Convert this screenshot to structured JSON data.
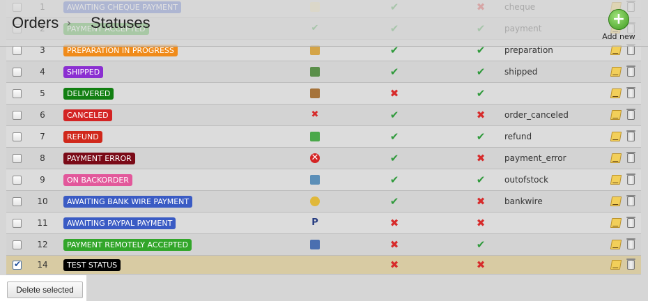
{
  "header": {
    "breadcrumb_root": "Orders",
    "breadcrumb_sep": "›",
    "breadcrumb_current": "Statuses",
    "add_new_label": "Add new",
    "add_new_icon": "+"
  },
  "rows": [
    {
      "id": "1",
      "status": "AWAITING CHEQUE PAYMENT",
      "color": "#4a64c8",
      "icon": "cheque-icon",
      "col1": "ok",
      "col2": "no",
      "template": "cheque",
      "checked": false
    },
    {
      "id": "2",
      "status": "PAYMENT ACCEPTED",
      "color": "#32a62a",
      "icon": "payment-icon",
      "col1": "ok",
      "col2": "ok",
      "template": "payment",
      "checked": false
    },
    {
      "id": "3",
      "status": "PREPARATION IN PROGRESS",
      "color": "#f08b1a",
      "icon": "box-icon",
      "col1": "ok",
      "col2": "ok",
      "template": "preparation",
      "checked": false
    },
    {
      "id": "4",
      "status": "SHIPPED",
      "color": "#8b2fd1",
      "icon": "truck-icon",
      "col1": "ok",
      "col2": "ok",
      "template": "shipped",
      "checked": false
    },
    {
      "id": "5",
      "status": "DELIVERED",
      "color": "#127f12",
      "icon": "door-icon",
      "col1": "no",
      "col2": "ok",
      "template": "",
      "checked": false
    },
    {
      "id": "6",
      "status": "CANCELED",
      "color": "#d32323",
      "icon": "cross-icon",
      "col1": "ok",
      "col2": "no",
      "template": "order_canceled",
      "checked": false
    },
    {
      "id": "7",
      "status": "REFUND",
      "color": "#d0281b",
      "icon": "money-icon",
      "col1": "ok",
      "col2": "ok",
      "template": "refund",
      "checked": false
    },
    {
      "id": "8",
      "status": "PAYMENT ERROR",
      "color": "#7a0a17",
      "icon": "error-icon",
      "col1": "ok",
      "col2": "no",
      "template": "payment_error",
      "checked": false
    },
    {
      "id": "9",
      "status": "ON BACKORDER",
      "color": "#e2589b",
      "icon": "backorder-icon",
      "col1": "ok",
      "col2": "ok",
      "template": "outofstock",
      "checked": false
    },
    {
      "id": "10",
      "status": "AWAITING BANK WIRE PAYMENT",
      "color": "#3a5bc4",
      "icon": "coins-icon",
      "col1": "ok",
      "col2": "no",
      "template": "bankwire",
      "checked": false
    },
    {
      "id": "11",
      "status": "AWAITING PAYPAL PAYMENT",
      "color": "#3a5bc4",
      "icon": "paypal-icon",
      "col1": "no",
      "col2": "no",
      "template": "",
      "checked": false
    },
    {
      "id": "12",
      "status": "PAYMENT REMOTELY ACCEPTED",
      "color": "#32a62a",
      "icon": "remote-payment-icon",
      "col1": "no",
      "col2": "ok",
      "template": "",
      "checked": false
    },
    {
      "id": "14",
      "status": "TEST STATUS",
      "color": "#000000",
      "icon": "",
      "col1": "no",
      "col2": "no",
      "template": "",
      "checked": true
    }
  ],
  "footer": {
    "delete_selected_label": "Delete selected"
  }
}
